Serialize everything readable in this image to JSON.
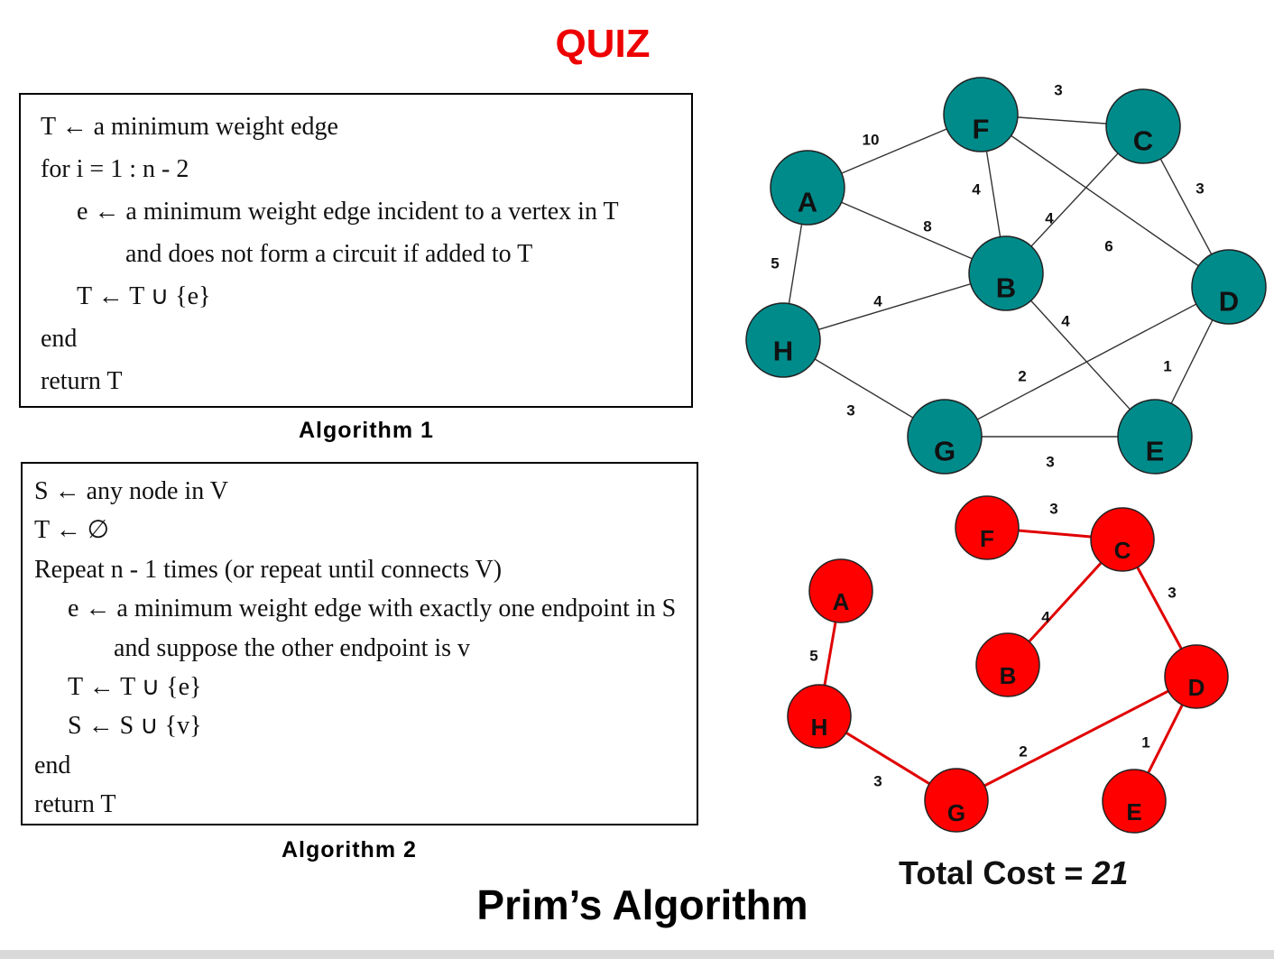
{
  "title": "QUIZ",
  "algorithm1": {
    "caption": "Algorithm 1",
    "lines": [
      "T ← a minimum weight edge",
      "for i = 1 : n - 2",
      "e ← a minimum weight edge incident to a vertex in T",
      "and does not form a circuit if added to T",
      "T ← T ∪ {e}",
      "end",
      "return T"
    ]
  },
  "algorithm2": {
    "caption": "Algorithm 2",
    "lines": [
      "S ← any node in V",
      "T ← ∅",
      "Repeat n - 1 times (or repeat until connects V)",
      "e ← a minimum weight edge with exactly one endpoint in S",
      "and suppose the other endpoint is v",
      "T ← T ∪ {e}",
      "S ← S ∪ {v}",
      "end",
      "return T"
    ]
  },
  "footer": "Prim’s Algorithm",
  "total_cost": {
    "label": "Total Cost = ",
    "value": "21"
  },
  "colors": {
    "title": "#ee0000",
    "graph_node": "#008b8b",
    "mst_node": "#ff0000",
    "mst_edge": "#e00000"
  },
  "graph": {
    "nodes": [
      "A",
      "B",
      "C",
      "D",
      "E",
      "F",
      "G",
      "H"
    ],
    "edges": [
      {
        "from": "A",
        "to": "F",
        "weight": "10"
      },
      {
        "from": "F",
        "to": "C",
        "weight": "3"
      },
      {
        "from": "C",
        "to": "D",
        "weight": "3"
      },
      {
        "from": "A",
        "to": "B",
        "weight": "8"
      },
      {
        "from": "F",
        "to": "B",
        "weight": "4"
      },
      {
        "from": "C",
        "to": "B",
        "weight": "4"
      },
      {
        "from": "F",
        "to": "D",
        "weight": "6"
      },
      {
        "from": "A",
        "to": "H",
        "weight": "5"
      },
      {
        "from": "H",
        "to": "B",
        "weight": "4"
      },
      {
        "from": "B",
        "to": "E",
        "weight": "4"
      },
      {
        "from": "G",
        "to": "D",
        "weight": "2"
      },
      {
        "from": "D",
        "to": "E",
        "weight": "1"
      },
      {
        "from": "H",
        "to": "G",
        "weight": "3"
      },
      {
        "from": "G",
        "to": "E",
        "weight": "3"
      }
    ]
  },
  "mst": {
    "nodes": [
      "A",
      "B",
      "C",
      "D",
      "E",
      "F",
      "G",
      "H"
    ],
    "edges": [
      {
        "from": "F",
        "to": "C",
        "weight": "3"
      },
      {
        "from": "C",
        "to": "D",
        "weight": "3"
      },
      {
        "from": "C",
        "to": "B",
        "weight": "4"
      },
      {
        "from": "A",
        "to": "H",
        "weight": "5"
      },
      {
        "from": "H",
        "to": "G",
        "weight": "3"
      },
      {
        "from": "G",
        "to": "D",
        "weight": "2"
      },
      {
        "from": "D",
        "to": "E",
        "weight": "1"
      }
    ]
  }
}
